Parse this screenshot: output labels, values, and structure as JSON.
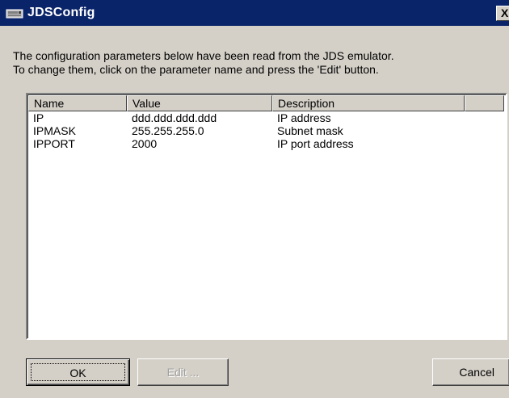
{
  "window": {
    "title": "JDSConfig",
    "close_label": "X",
    "titlebar_color": "#0a246a",
    "face_color": "#d4d0c8",
    "icon": "app-window-icon"
  },
  "message": {
    "line1": "The configuration parameters below have been read from the JDS emulator.",
    "line2": "To change them, click on the parameter name and press the 'Edit' button."
  },
  "table": {
    "columns": [
      "Name",
      "Value",
      "Description",
      ""
    ],
    "rows": [
      {
        "name": "IP",
        "value": "ddd.ddd.ddd.ddd",
        "description": "IP address"
      },
      {
        "name": "IPMASK",
        "value": "255.255.255.0",
        "description": "Subnet mask"
      },
      {
        "name": "IPPORT",
        "value": "2000",
        "description": "IP port address"
      }
    ]
  },
  "buttons": {
    "ok": "OK",
    "edit": "Edit ...",
    "cancel": "Cancel"
  }
}
